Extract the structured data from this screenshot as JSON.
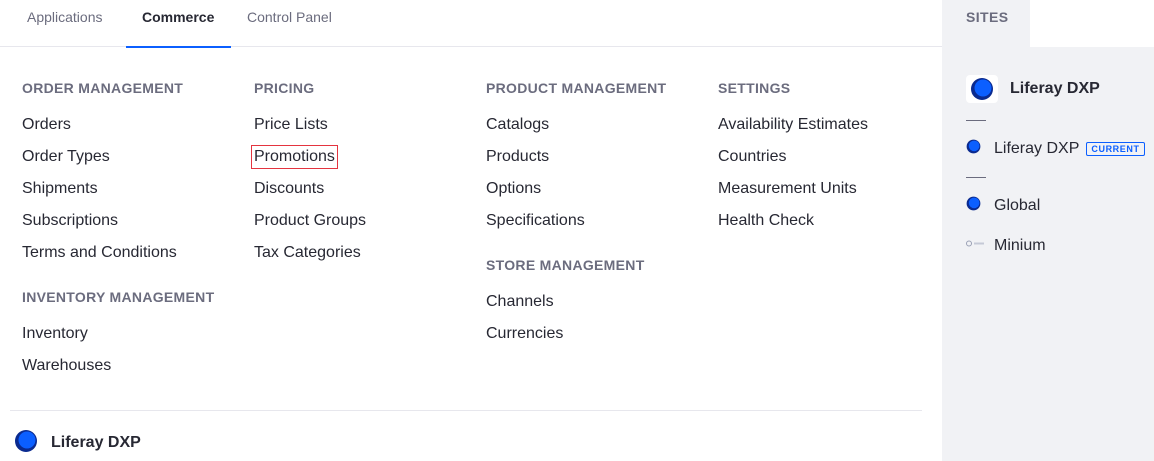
{
  "tabs": [
    {
      "label": "Applications"
    },
    {
      "label": "Commerce"
    },
    {
      "label": "Control Panel"
    }
  ],
  "active_tab": "Commerce",
  "columns": {
    "order_management": {
      "title": "ORDER MANAGEMENT",
      "items": [
        "Orders",
        "Order Types",
        "Shipments",
        "Subscriptions",
        "Terms and Conditions"
      ]
    },
    "inventory_management": {
      "title": "INVENTORY MANAGEMENT",
      "items": [
        "Inventory",
        "Warehouses"
      ]
    },
    "pricing": {
      "title": "PRICING",
      "items": [
        "Price Lists",
        "Promotions",
        "Discounts",
        "Product Groups",
        "Tax Categories"
      ]
    },
    "product_management": {
      "title": "PRODUCT MANAGEMENT",
      "items": [
        "Catalogs",
        "Products",
        "Options",
        "Specifications"
      ]
    },
    "store_management": {
      "title": "STORE MANAGEMENT",
      "items": [
        "Channels",
        "Currencies"
      ]
    },
    "settings": {
      "title": "SETTINGS",
      "items": [
        "Availability Estimates",
        "Countries",
        "Measurement Units",
        "Health Check"
      ]
    }
  },
  "highlighted_item": "Promotions",
  "footer": {
    "site_name": "Liferay DXP"
  },
  "sidebar": {
    "tab_label": "SITES",
    "current_site": "Liferay DXP",
    "sites": [
      {
        "name": "Liferay DXP",
        "badge": "CURRENT"
      },
      {
        "name": "Global"
      },
      {
        "name": "Minium"
      }
    ]
  },
  "colors": {
    "accent": "#0b5fff",
    "highlight_border": "#e4343f",
    "sidebar_bg": "#f1f2f5",
    "logo_blue": "#0b5fff",
    "logo_dark": "#0a2a8f"
  }
}
